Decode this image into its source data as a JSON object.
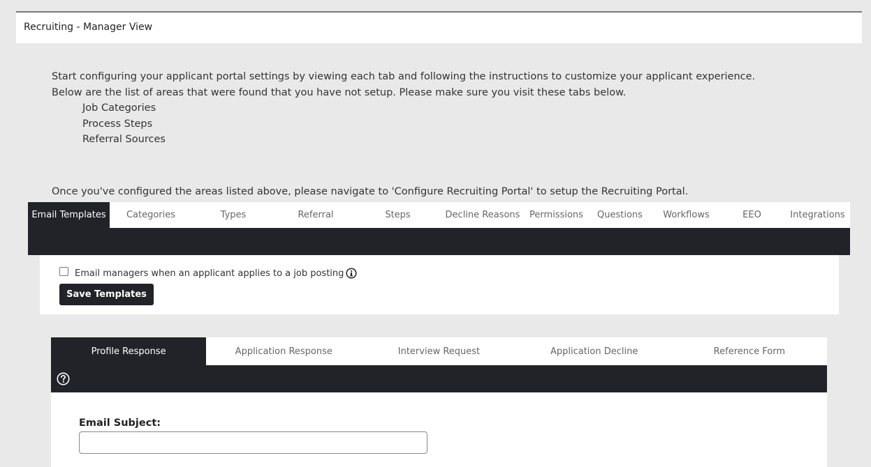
{
  "header": {
    "title": "Recruiting - Manager View"
  },
  "intro": {
    "line1": "Start configuring your applicant portal settings by viewing each tab and following the instructions to customize your applicant experience.",
    "line2": "Below are the list of areas that were found that you have not setup. Please make sure you visit these tabs below.",
    "missing_areas": [
      "Job Categories",
      "Process Steps",
      "Referral Sources"
    ],
    "after_note": "Once you've configured the areas listed above, please navigate to 'Configure Recruiting Portal' to setup the Recruiting Portal."
  },
  "main_tabs": [
    {
      "label": "Email Templates",
      "active": true
    },
    {
      "label": "Categories"
    },
    {
      "label": "Types"
    },
    {
      "label": "Referral"
    },
    {
      "label": "Steps"
    },
    {
      "label": "Decline Reasons"
    },
    {
      "label": "Permissions"
    },
    {
      "label": "Questions"
    },
    {
      "label": "Workflows"
    },
    {
      "label": "EEO"
    },
    {
      "label": "Integrations"
    }
  ],
  "settings": {
    "email_managers_label": "Email managers when an applicant applies to a job posting",
    "email_managers_checked": false,
    "save_label": "Save Templates"
  },
  "template_tabs": [
    {
      "label": "Profile Response",
      "active": true
    },
    {
      "label": "Application Response"
    },
    {
      "label": "Interview Request"
    },
    {
      "label": "Application Decline"
    },
    {
      "label": "Reference Form"
    }
  ],
  "email_form": {
    "subject_label": "Email Subject:",
    "subject_value": ""
  },
  "colors": {
    "dark": "#212329",
    "page_bg": "#e9e9e9"
  }
}
